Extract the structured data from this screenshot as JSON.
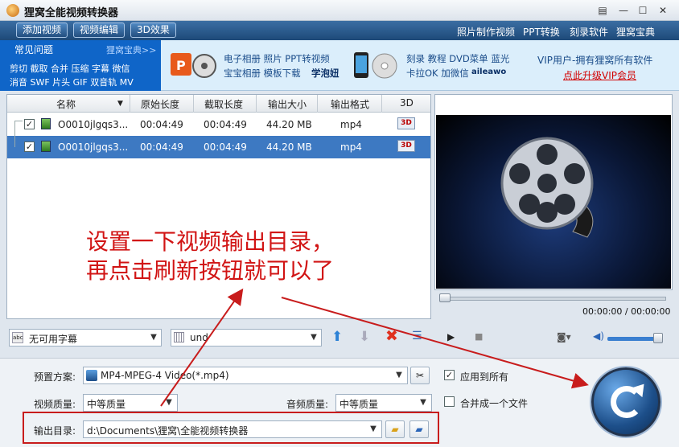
{
  "app": {
    "title": "狸窝全能视频转换器",
    "window_controls": [
      "▤",
      "—",
      "☐",
      "✕"
    ]
  },
  "toolbar": {
    "buttons": [
      "添加视频",
      "视频编辑",
      "3D效果"
    ],
    "links": [
      "照片制作视频",
      "PPT转换",
      "刻录软件",
      "狸窝宝典"
    ]
  },
  "banner": {
    "faq_title": "常见问题",
    "faq_more": "狸窝宝典>>",
    "faq_line1": "剪切 截取 合并 压缩 字幕 微信",
    "faq_line2": "消音 SWF 片头 GIF 双音轨 MV",
    "ppt_line1": "电子相册 照片 PPT转视频",
    "ppt_line2": "宝宝相册 模板下载",
    "ppt_line2_bold": "学泡妞",
    "burn_line1": "刻录 教程 DVD菜单 蓝光",
    "burn_line2": "卡拉OK 加微信",
    "burn_wechat": "aileawo",
    "vip_text": "VIP用户-拥有狸窝所有软件",
    "vip_link": "点此升级VIP会员"
  },
  "file_list": {
    "columns": [
      "名称",
      "原始长度",
      "截取长度",
      "输出大小",
      "输出格式",
      "3D"
    ],
    "rows": [
      {
        "name": "O0010jlgqs3...",
        "original": "00:04:49",
        "clip": "00:04:49",
        "size": "44.20 MB",
        "format": "mp4",
        "selected": false,
        "checked": "✓"
      },
      {
        "name": "O0010jlgqs3...",
        "original": "00:04:49",
        "clip": "00:04:49",
        "size": "44.20 MB",
        "format": "mp4",
        "selected": true,
        "checked": "✓"
      }
    ]
  },
  "player": {
    "time": "00:00:00 / 00:00:00",
    "volume": 0.8,
    "seek": 0.0
  },
  "controls": {
    "subtitle": "无可用字幕",
    "audio_track": "und"
  },
  "settings": {
    "preset_label": "预置方案:",
    "preset_value": "MP4-MPEG-4 Video(*.mp4)",
    "apply_all": "应用到所有",
    "apply_all_checked": "✓",
    "video_quality_label": "视频质量:",
    "video_quality": "中等质量",
    "audio_quality_label": "音频质量:",
    "audio_quality": "中等质量",
    "merge": "合并成一个文件",
    "output_label": "输出目录:",
    "output_path": "d:\\Documents\\狸窝\\全能视频转换器"
  },
  "annotation": {
    "line1": "设置一下视频输出目录，",
    "line2": "再点击刷新按钮就可以了"
  },
  "colors": {
    "toolbar": "#1d4978",
    "faq_bg": "#0f65c8",
    "selected_row": "#3d79c2",
    "annotation": "#d11414"
  }
}
